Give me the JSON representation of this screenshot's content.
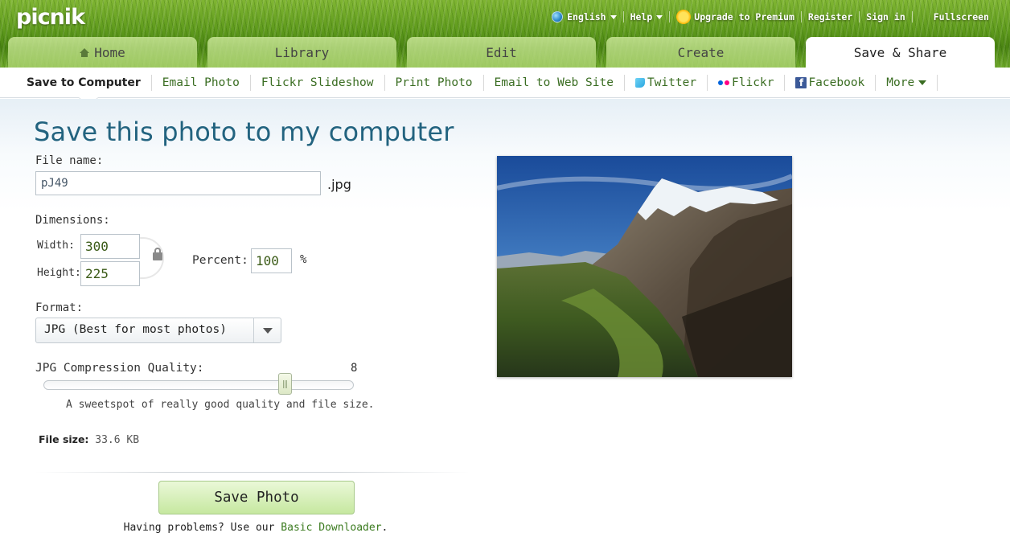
{
  "app": {
    "logo": "picnik"
  },
  "topnav": {
    "language": "English",
    "help": "Help",
    "upgrade": "Upgrade to Premium",
    "register": "Register",
    "sign_in": "Sign in",
    "fullscreen": "Fullscreen"
  },
  "tabs": [
    {
      "label": "Home",
      "icon": "home-icon"
    },
    {
      "label": "Library"
    },
    {
      "label": "Edit"
    },
    {
      "label": "Create"
    },
    {
      "label": "Save & Share",
      "active": true
    }
  ],
  "subnav": [
    {
      "label": "Save to Computer",
      "active": true
    },
    {
      "label": "Email Photo"
    },
    {
      "label": "Flickr Slideshow"
    },
    {
      "label": "Print Photo"
    },
    {
      "label": "Email to Web Site"
    },
    {
      "label": "Twitter",
      "icon": "twitter-icon"
    },
    {
      "label": "Flickr",
      "icon": "flickr-icon"
    },
    {
      "label": "Facebook",
      "icon": "facebook-icon"
    },
    {
      "label": "More"
    }
  ],
  "form": {
    "title": "Save this photo to my computer",
    "file_name_label": "File name:",
    "file_name_value": "pJ49",
    "extension": ".jpg",
    "dimensions_label": "Dimensions:",
    "width_label": "Width:",
    "width_value": "300",
    "height_label": "Height:",
    "height_value": "225",
    "percent_label": "Percent:",
    "percent_value": "100",
    "percent_sign": "%",
    "format_label": "Format:",
    "format_value": "JPG  (Best for most photos)",
    "quality_label": "JPG Compression Quality:",
    "quality_value": "8",
    "quality_fraction": 0.8,
    "quality_hint": "A sweetspot of really good quality and file size.",
    "file_size_label": "File size:",
    "file_size_value": "33.6 KB",
    "save_button": "Save Photo",
    "help_prefix": "Having problems? Use our ",
    "help_link": "Basic Downloader",
    "help_suffix": "."
  },
  "colors": {
    "title": "#22637f",
    "link": "#3a7a1e",
    "save_button_top": "#eaf8d8",
    "save_button_bottom": "#c6e8a0"
  }
}
